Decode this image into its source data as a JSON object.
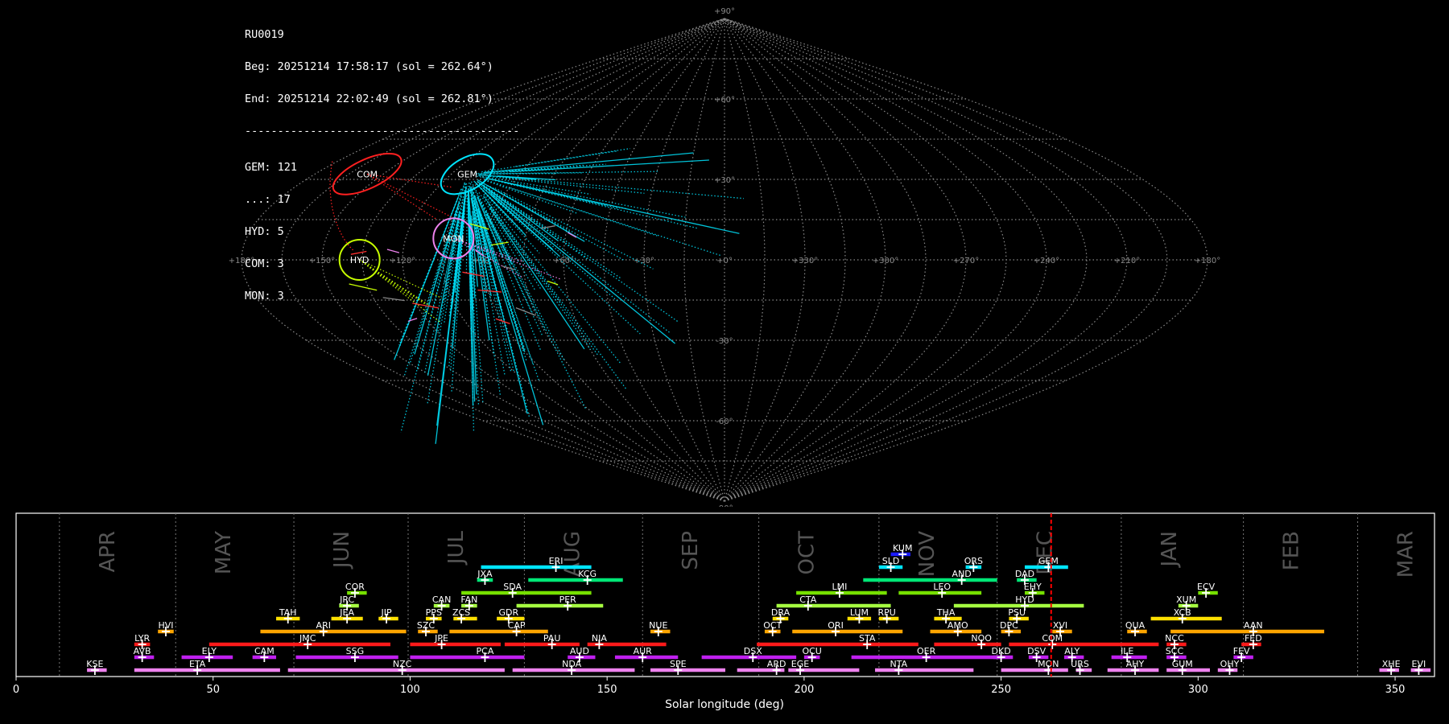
{
  "header": {
    "station": "RU0019",
    "beg": "Beg: 20251214 17:58:17 (sol = 262.64°)",
    "end": "End: 20251214 22:02:49 (sol = 262.81°)",
    "separator": "------------------------------------------"
  },
  "counts": [
    "GEM: 121",
    "...: 17",
    "HYD: 5",
    "COM: 3",
    "MON: 3"
  ],
  "chart_data": [
    {
      "type": "scatter",
      "title": "",
      "projection": "sinusoidal",
      "lon_ticks": [
        180,
        150,
        120,
        90,
        60,
        30,
        0,
        330,
        300,
        270,
        240,
        210,
        180
      ],
      "lon_tick_labels": [
        "+180°",
        "+150°",
        "+120°",
        "+90°",
        "+60°",
        "+30°",
        "+0°",
        "+330°",
        "+300°",
        "+270°",
        "+240°",
        "+210°",
        "+180°"
      ],
      "lat_tick_labels": [
        "+90°",
        "+60°",
        "+30°",
        "-30°",
        "-60°",
        "-90°"
      ],
      "grid": true,
      "colors": {
        "GEM": "#00e5ff",
        "COM": "#ff2020",
        "HYD": "#c8ff00",
        "MON": "#ee82ee",
        "sporadic": "#ff3030"
      },
      "radiants": [
        {
          "code": "GEM",
          "lon": 113,
          "lat": 32,
          "color": "#00e5ff"
        },
        {
          "code": "COM",
          "lon": 157,
          "lat": 32,
          "color": "#ff2020"
        },
        {
          "code": "HYD",
          "lon": 136,
          "lat": 0,
          "color": "#c8ff00"
        },
        {
          "code": "MON",
          "lon": 102,
          "lat": 8,
          "color": "#ee82ee"
        }
      ]
    },
    {
      "type": "bar",
      "title": "",
      "xlabel": "Solar longitude (deg)",
      "xlim": [
        0,
        360
      ],
      "x_ticks": [
        0,
        50,
        100,
        150,
        200,
        250,
        300,
        350
      ],
      "current_sol": 262.7,
      "months": [
        {
          "label": "APR",
          "start": 11
        },
        {
          "label": "MAY",
          "start": 40.5
        },
        {
          "label": "JUN",
          "start": 70.5
        },
        {
          "label": "JUL",
          "start": 99.5
        },
        {
          "label": "AUG",
          "start": 129
        },
        {
          "label": "SEP",
          "start": 159
        },
        {
          "label": "OCT",
          "start": 188.5
        },
        {
          "label": "NOV",
          "start": 219
        },
        {
          "label": "DEC",
          "start": 249
        },
        {
          "label": "JAN",
          "start": 280.5
        },
        {
          "label": "FEB",
          "start": 311.5
        },
        {
          "label": "MAR",
          "start": 340.5
        }
      ],
      "showers": [
        {
          "code": "KUM",
          "start": 222,
          "end": 227,
          "peak": 225,
          "row": 9,
          "color": "#1a1aff"
        },
        {
          "code": "ERI",
          "start": 118,
          "end": 146,
          "peak": 137,
          "row": 8,
          "color": "#00e5ff"
        },
        {
          "code": "SLD",
          "start": 219,
          "end": 225,
          "peak": 222,
          "row": 8,
          "color": "#00e5ff"
        },
        {
          "code": "ORS",
          "start": 241,
          "end": 245,
          "peak": 243,
          "row": 8,
          "color": "#00e5ff"
        },
        {
          "code": "GEM",
          "start": 256,
          "end": 267,
          "peak": 262,
          "row": 8,
          "color": "#00e5ff"
        },
        {
          "code": "JXA",
          "start": 117,
          "end": 121,
          "peak": 119,
          "row": 7,
          "color": "#00e676"
        },
        {
          "code": "KCG",
          "start": 130,
          "end": 154,
          "peak": 145,
          "row": 7,
          "color": "#00e676"
        },
        {
          "code": "AND",
          "start": 215,
          "end": 249,
          "peak": 240,
          "row": 7,
          "color": "#00e676"
        },
        {
          "code": "DAD",
          "start": 254,
          "end": 259,
          "peak": 256,
          "row": 7,
          "color": "#00e676"
        },
        {
          "code": "COR",
          "start": 84,
          "end": 89,
          "peak": 86,
          "row": 6,
          "color": "#76e000"
        },
        {
          "code": "SDA",
          "start": 113,
          "end": 146,
          "peak": 126,
          "row": 6,
          "color": "#76e000"
        },
        {
          "code": "LMI",
          "start": 198,
          "end": 221,
          "peak": 209,
          "row": 6,
          "color": "#76e000"
        },
        {
          "code": "LEO",
          "start": 224,
          "end": 245,
          "peak": 235,
          "row": 6,
          "color": "#76e000"
        },
        {
          "code": "EHY",
          "start": 256,
          "end": 261,
          "peak": 258,
          "row": 6,
          "color": "#76e000"
        },
        {
          "code": "ECV",
          "start": 300,
          "end": 305,
          "peak": 302,
          "row": 6,
          "color": "#76e000"
        },
        {
          "code": "JRC",
          "start": 82,
          "end": 87,
          "peak": 84,
          "row": 5,
          "color": "#a6ff40"
        },
        {
          "code": "CAN",
          "start": 106,
          "end": 110,
          "peak": 108,
          "row": 5,
          "color": "#a6ff40"
        },
        {
          "code": "FAN",
          "start": 113,
          "end": 117,
          "peak": 115,
          "row": 5,
          "color": "#a6ff40"
        },
        {
          "code": "PER",
          "start": 127,
          "end": 149,
          "peak": 140,
          "row": 5,
          "color": "#a6ff40"
        },
        {
          "code": "CTA",
          "start": 193,
          "end": 222,
          "peak": 201,
          "row": 5,
          "color": "#a6ff40"
        },
        {
          "code": "HYD",
          "start": 238,
          "end": 271,
          "peak": 256,
          "row": 5,
          "color": "#a6ff40"
        },
        {
          "code": "XUM",
          "start": 295,
          "end": 300,
          "peak": 297,
          "row": 5,
          "color": "#a6ff40"
        },
        {
          "code": "TAH",
          "start": 66,
          "end": 72,
          "peak": 69,
          "row": 4,
          "color": "#ffe000"
        },
        {
          "code": "JEA",
          "start": 80,
          "end": 88,
          "peak": 84,
          "row": 4,
          "color": "#ffe000"
        },
        {
          "code": "JIP",
          "start": 92,
          "end": 97,
          "peak": 94,
          "row": 4,
          "color": "#ffe000"
        },
        {
          "code": "PPS",
          "start": 104,
          "end": 108,
          "peak": 106,
          "row": 4,
          "color": "#ffe000"
        },
        {
          "code": "ZCS",
          "start": 111,
          "end": 117,
          "peak": 113,
          "row": 4,
          "color": "#ffe000"
        },
        {
          "code": "GDR",
          "start": 122,
          "end": 129,
          "peak": 125,
          "row": 4,
          "color": "#ffe000"
        },
        {
          "code": "DRA",
          "start": 192,
          "end": 196,
          "peak": 194,
          "row": 4,
          "color": "#ffe000"
        },
        {
          "code": "LUM",
          "start": 211,
          "end": 217,
          "peak": 214,
          "row": 4,
          "color": "#ffe000"
        },
        {
          "code": "RPU",
          "start": 219,
          "end": 224,
          "peak": 221,
          "row": 4,
          "color": "#ffe000"
        },
        {
          "code": "THA",
          "start": 233,
          "end": 240,
          "peak": 236,
          "row": 4,
          "color": "#ffe000"
        },
        {
          "code": "PSU",
          "start": 252,
          "end": 257,
          "peak": 254,
          "row": 4,
          "color": "#ffe000"
        },
        {
          "code": "XCB",
          "start": 288,
          "end": 306,
          "peak": 296,
          "row": 4,
          "color": "#ffe000"
        },
        {
          "code": "HVI",
          "start": 36,
          "end": 40,
          "peak": 38,
          "row": 3,
          "color": "#ffa500"
        },
        {
          "code": "ARI",
          "start": 62,
          "end": 99,
          "peak": 78,
          "row": 3,
          "color": "#ffa500"
        },
        {
          "code": "SZC",
          "start": 102,
          "end": 107,
          "peak": 104,
          "row": 3,
          "color": "#ffa500"
        },
        {
          "code": "CAP",
          "start": 110,
          "end": 135,
          "peak": 127,
          "row": 3,
          "color": "#ffa500"
        },
        {
          "code": "NUE",
          "start": 161,
          "end": 166,
          "peak": 163,
          "row": 3,
          "color": "#ffa500"
        },
        {
          "code": "OCT",
          "start": 190,
          "end": 194,
          "peak": 192,
          "row": 3,
          "color": "#ffa500"
        },
        {
          "code": "ORI",
          "start": 197,
          "end": 225,
          "peak": 208,
          "row": 3,
          "color": "#ffa500"
        },
        {
          "code": "AMO",
          "start": 232,
          "end": 245,
          "peak": 239,
          "row": 3,
          "color": "#ffa500"
        },
        {
          "code": "DPC",
          "start": 250,
          "end": 255,
          "peak": 252,
          "row": 3,
          "color": "#ffa500"
        },
        {
          "code": "XVI",
          "start": 263,
          "end": 268,
          "peak": 265,
          "row": 3,
          "color": "#ffa500"
        },
        {
          "code": "QUA",
          "start": 282,
          "end": 287,
          "peak": 284,
          "row": 3,
          "color": "#ffa500"
        },
        {
          "code": "AAN",
          "start": 293,
          "end": 332,
          "peak": 314,
          "row": 3,
          "color": "#ffa500"
        },
        {
          "code": "LYR",
          "start": 30,
          "end": 34,
          "peak": 32,
          "row": 2,
          "color": "#ff1a1a"
        },
        {
          "code": "JMC",
          "start": 49,
          "end": 95,
          "peak": 74,
          "row": 2,
          "color": "#ff1a1a"
        },
        {
          "code": "JPE",
          "start": 100,
          "end": 123,
          "peak": 108,
          "row": 2,
          "color": "#ff1a1a"
        },
        {
          "code": "PAU",
          "start": 124,
          "end": 143,
          "peak": 136,
          "row": 2,
          "color": "#ff1a1a"
        },
        {
          "code": "NIA",
          "start": 145,
          "end": 165,
          "peak": 148,
          "row": 2,
          "color": "#ff1a1a"
        },
        {
          "code": "STA",
          "start": 188,
          "end": 229,
          "peak": 216,
          "row": 2,
          "color": "#ff1a1a"
        },
        {
          "code": "NOO",
          "start": 233,
          "end": 250,
          "peak": 245,
          "row": 2,
          "color": "#ff1a1a"
        },
        {
          "code": "COM",
          "start": 252,
          "end": 290,
          "peak": 263,
          "row": 2,
          "color": "#ff1a1a"
        },
        {
          "code": "NCC",
          "start": 292,
          "end": 297,
          "peak": 294,
          "row": 2,
          "color": "#ff1a1a"
        },
        {
          "code": "FED",
          "start": 311,
          "end": 316,
          "peak": 314,
          "row": 2,
          "color": "#ff1a1a"
        },
        {
          "code": "AVB",
          "start": 30,
          "end": 35,
          "peak": 32,
          "row": 1,
          "color": "#c020f0"
        },
        {
          "code": "ELY",
          "start": 42,
          "end": 55,
          "peak": 49,
          "row": 1,
          "color": "#c020f0"
        },
        {
          "code": "CAM",
          "start": 60,
          "end": 66,
          "peak": 63,
          "row": 1,
          "color": "#c020f0"
        },
        {
          "code": "SSG",
          "start": 71,
          "end": 97,
          "peak": 86,
          "row": 1,
          "color": "#c020f0"
        },
        {
          "code": "PCA",
          "start": 100,
          "end": 129,
          "peak": 119,
          "row": 1,
          "color": "#c020f0"
        },
        {
          "code": "AUD",
          "start": 140,
          "end": 147,
          "peak": 143,
          "row": 1,
          "color": "#c020f0"
        },
        {
          "code": "AUR",
          "start": 152,
          "end": 168,
          "peak": 159,
          "row": 1,
          "color": "#c020f0"
        },
        {
          "code": "DSX",
          "start": 174,
          "end": 198,
          "peak": 187,
          "row": 1,
          "color": "#c020f0"
        },
        {
          "code": "OCU",
          "start": 200,
          "end": 204,
          "peak": 202,
          "row": 1,
          "color": "#c020f0"
        },
        {
          "code": "OER",
          "start": 212,
          "end": 250,
          "peak": 231,
          "row": 1,
          "color": "#c020f0"
        },
        {
          "code": "DKD",
          "start": 248,
          "end": 253,
          "peak": 250,
          "row": 1,
          "color": "#c020f0"
        },
        {
          "code": "DSV",
          "start": 257,
          "end": 262,
          "peak": 259,
          "row": 1,
          "color": "#c020f0"
        },
        {
          "code": "ALY",
          "start": 266,
          "end": 271,
          "peak": 268,
          "row": 1,
          "color": "#c020f0"
        },
        {
          "code": "ILE",
          "start": 278,
          "end": 287,
          "peak": 282,
          "row": 1,
          "color": "#c020f0"
        },
        {
          "code": "SCC",
          "start": 292,
          "end": 297,
          "peak": 294,
          "row": 1,
          "color": "#c020f0"
        },
        {
          "code": "FEV",
          "start": 309,
          "end": 314,
          "peak": 311,
          "row": 1,
          "color": "#c020f0"
        },
        {
          "code": "KSE",
          "start": 18,
          "end": 23,
          "peak": 20,
          "row": 0,
          "color": "#ee82ee"
        },
        {
          "code": "ETA",
          "start": 30,
          "end": 67,
          "peak": 46,
          "row": 0,
          "color": "#ee82ee"
        },
        {
          "code": "NZC",
          "start": 69,
          "end": 124,
          "peak": 98,
          "row": 0,
          "color": "#ee82ee"
        },
        {
          "code": "NDA",
          "start": 126,
          "end": 157,
          "peak": 141,
          "row": 0,
          "color": "#ee82ee"
        },
        {
          "code": "SPE",
          "start": 161,
          "end": 180,
          "peak": 168,
          "row": 0,
          "color": "#ee82ee"
        },
        {
          "code": "ARD",
          "start": 183,
          "end": 195,
          "peak": 193,
          "row": 0,
          "color": "#ee82ee"
        },
        {
          "code": "EGE",
          "start": 196,
          "end": 214,
          "peak": 199,
          "row": 0,
          "color": "#ee82ee"
        },
        {
          "code": "NTA",
          "start": 218,
          "end": 243,
          "peak": 224,
          "row": 0,
          "color": "#ee82ee"
        },
        {
          "code": "MON",
          "start": 250,
          "end": 267,
          "peak": 262,
          "row": 0,
          "color": "#ee82ee"
        },
        {
          "code": "URS",
          "start": 269,
          "end": 273,
          "peak": 270,
          "row": 0,
          "color": "#ee82ee"
        },
        {
          "code": "AHY",
          "start": 277,
          "end": 290,
          "peak": 284,
          "row": 0,
          "color": "#ee82ee"
        },
        {
          "code": "GUM",
          "start": 292,
          "end": 303,
          "peak": 296,
          "row": 0,
          "color": "#ee82ee"
        },
        {
          "code": "OHY",
          "start": 305,
          "end": 310,
          "peak": 308,
          "row": 0,
          "color": "#ee82ee"
        },
        {
          "code": "XHE",
          "start": 346,
          "end": 351,
          "peak": 349,
          "row": 0,
          "color": "#ee82ee"
        },
        {
          "code": "EVI",
          "start": 354,
          "end": 359,
          "peak": 356,
          "row": 0,
          "color": "#ee82ee"
        }
      ]
    }
  ]
}
